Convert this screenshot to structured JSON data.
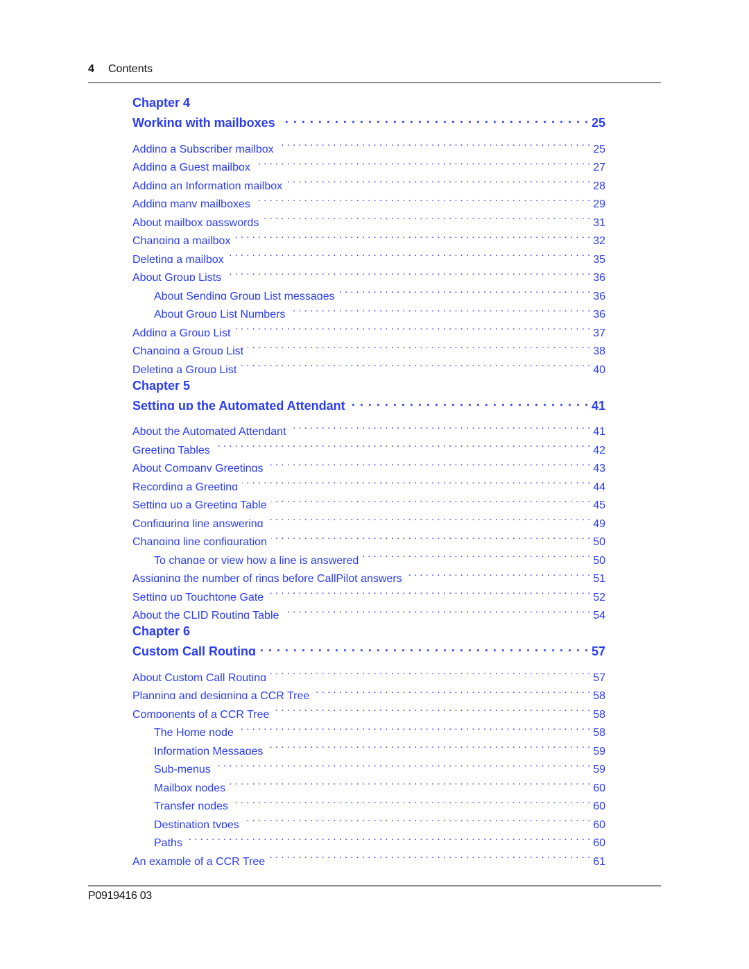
{
  "header": {
    "page_number": "4",
    "section_title": "Contents"
  },
  "chapters": [
    {
      "label": "Chapter 4",
      "title": "Working with mailboxes",
      "page": "25",
      "entries": [
        {
          "text": "Adding a Subscriber mailbox",
          "page": "25",
          "level": 1
        },
        {
          "text": "Adding a Guest mailbox",
          "page": "27",
          "level": 1
        },
        {
          "text": "Adding an Information mailbox",
          "page": "28",
          "level": 1
        },
        {
          "text": "Adding many mailboxes",
          "page": "29",
          "level": 1
        },
        {
          "text": "About mailbox passwords",
          "page": "31",
          "level": 1
        },
        {
          "text": "Changing a mailbox",
          "page": "32",
          "level": 1
        },
        {
          "text": "Deleting a mailbox",
          "page": "35",
          "level": 1
        },
        {
          "text": "About Group Lists",
          "page": "36",
          "level": 1
        },
        {
          "text": "About Sending Group List messages",
          "page": "36",
          "level": 2
        },
        {
          "text": "About Group List Numbers",
          "page": "36",
          "level": 2
        },
        {
          "text": "Adding a Group List",
          "page": "37",
          "level": 1
        },
        {
          "text": "Changing a Group List",
          "page": "38",
          "level": 1
        },
        {
          "text": "Deleting a Group List",
          "page": "40",
          "level": 1
        }
      ]
    },
    {
      "label": "Chapter 5",
      "title": "Setting up the Automated Attendant",
      "page": "41",
      "entries": [
        {
          "text": "About the Automated Attendant",
          "page": "41",
          "level": 1
        },
        {
          "text": "Greeting Tables",
          "page": "42",
          "level": 1
        },
        {
          "text": "About Company Greetings",
          "page": "43",
          "level": 1
        },
        {
          "text": "Recording a Greeting",
          "page": "44",
          "level": 1
        },
        {
          "text": "Setting up a Greeting Table",
          "page": "45",
          "level": 1
        },
        {
          "text": "Configuring line answering",
          "page": "49",
          "level": 1
        },
        {
          "text": "Changing line configuration",
          "page": "50",
          "level": 1
        },
        {
          "text": "To change or view how a line is answered",
          "page": "50",
          "level": 2
        },
        {
          "text": "Assigning the number of rings before CallPilot answers",
          "page": "51",
          "level": 1
        },
        {
          "text": "Setting up Touchtone Gate",
          "page": "52",
          "level": 1
        },
        {
          "text": "About the CLID Routing Table",
          "page": "54",
          "level": 1
        }
      ]
    },
    {
      "label": "Chapter 6",
      "title": "Custom Call Routing",
      "page": "57",
      "entries": [
        {
          "text": "About Custom Call Routing",
          "page": "57",
          "level": 1
        },
        {
          "text": "Planning and designing a CCR Tree",
          "page": "58",
          "level": 1
        },
        {
          "text": "Components of a CCR Tree",
          "page": "58",
          "level": 1
        },
        {
          "text": "The Home node",
          "page": "58",
          "level": 2
        },
        {
          "text": "Information Messages",
          "page": "59",
          "level": 2
        },
        {
          "text": "Sub-menus",
          "page": "59",
          "level": 2
        },
        {
          "text": "Mailbox nodes",
          "page": "60",
          "level": 2
        },
        {
          "text": "Transfer nodes",
          "page": "60",
          "level": 2
        },
        {
          "text": "Destination types",
          "page": "60",
          "level": 2
        },
        {
          "text": "Paths",
          "page": "60",
          "level": 2
        },
        {
          "text": "An example of a CCR Tree",
          "page": "61",
          "level": 1
        }
      ]
    }
  ],
  "footer": {
    "document_code": "P0919416 03"
  },
  "colors": {
    "link": "#2a3cf2",
    "text": "#111111",
    "rule": "#8a8a8a"
  }
}
